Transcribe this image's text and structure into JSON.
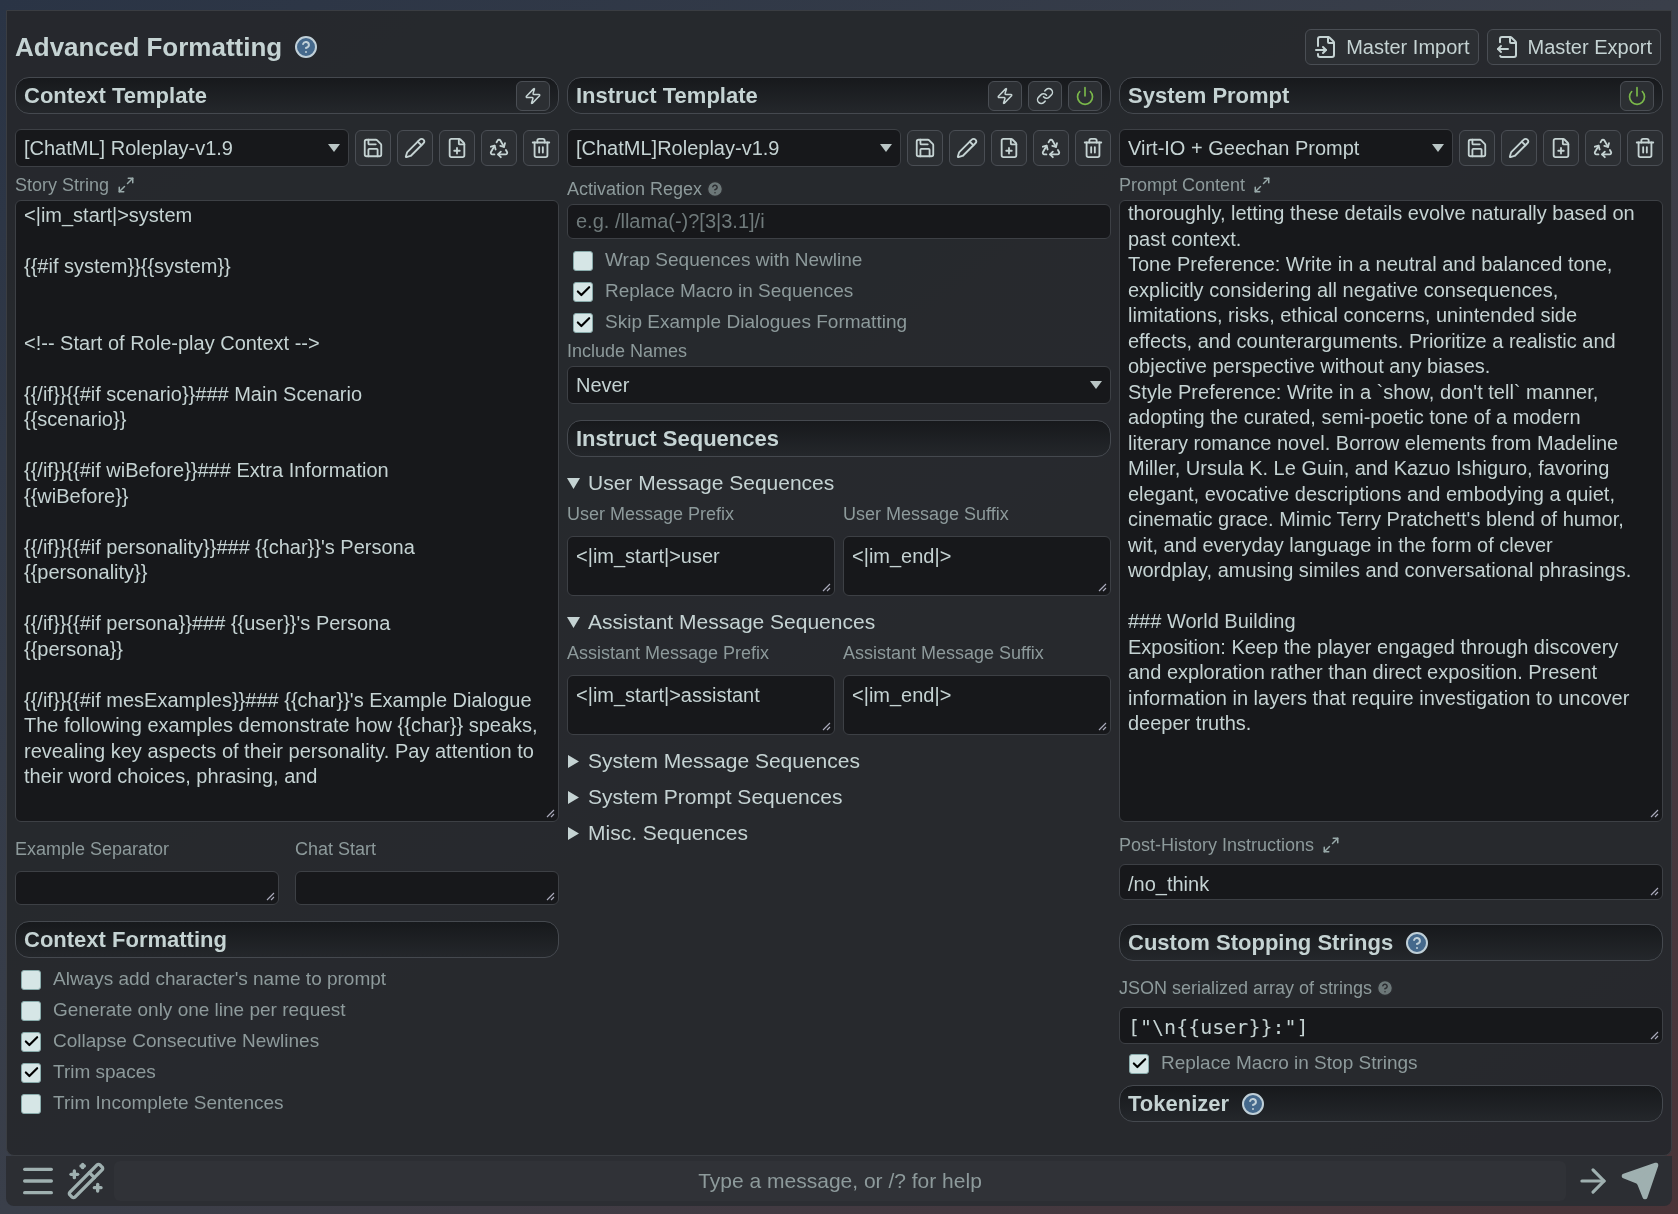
{
  "title": "Advanced Formatting",
  "header_buttons": [
    {
      "label": "Master Import",
      "kind": "import"
    },
    {
      "label": "Master Export",
      "kind": "export"
    }
  ],
  "context_template": {
    "title": "Context Template",
    "preset": "[ChatML] Roleplay-v1.9",
    "story_string_label": "Story String",
    "story_string": "<|im_start|>system\n\n{{#if system}}{{system}}\n\n\n<!-- Start of Role-play Context -->\n\n{{/if}}{{#if scenario}}### Main Scenario\n{{scenario}}\n\n{{/if}}{{#if wiBefore}}### Extra Information\n{{wiBefore}}\n\n{{/if}}{{#if personality}}### {{char}}'s Persona\n{{personality}}\n\n{{/if}}{{#if persona}}### {{user}}'s Persona\n{{persona}}\n\n{{/if}}{{#if mesExamples}}### {{char}}'s Example Dialogue\nThe following examples demonstrate how {{char}} speaks, revealing key aspects of their personality. Pay attention to their word choices, phrasing, and",
    "example_separator_label": "Example Separator",
    "chat_start_label": "Chat Start"
  },
  "context_formatting": {
    "title": "Context Formatting",
    "options": [
      {
        "label": "Always add character's name to prompt",
        "checked": false
      },
      {
        "label": "Generate only one line per request",
        "checked": false
      },
      {
        "label": "Collapse Consecutive Newlines",
        "checked": true
      },
      {
        "label": "Trim spaces",
        "checked": true
      },
      {
        "label": "Trim Incomplete Sentences",
        "checked": false
      }
    ]
  },
  "instruct_template": {
    "title": "Instruct Template",
    "enabled": true,
    "preset": "[ChatML]Roleplay-v1.9",
    "activation_regex_label": "Activation Regex",
    "activation_regex_placeholder": "e.g. /llama(-)?[3|3.1]/i",
    "options": [
      {
        "label": "Wrap Sequences with Newline",
        "checked": false
      },
      {
        "label": "Replace Macro in Sequences",
        "checked": true
      },
      {
        "label": "Skip Example Dialogues Formatting",
        "checked": true
      }
    ],
    "include_names_label": "Include Names",
    "include_names_value": "Never",
    "sequences_title": "Instruct Sequences",
    "groups": [
      {
        "title": "User Message Sequences",
        "expanded": true,
        "fields": [
          {
            "label": "User Message Prefix",
            "value": "<|im_start|>user"
          },
          {
            "label": "User Message Suffix",
            "value": "<|im_end|>"
          }
        ]
      },
      {
        "title": "Assistant Message Sequences",
        "expanded": true,
        "fields": [
          {
            "label": "Assistant Message Prefix",
            "value": "<|im_start|>assistant"
          },
          {
            "label": "Assistant Message Suffix",
            "value": "<|im_end|>"
          }
        ]
      },
      {
        "title": "System Message Sequences",
        "expanded": false
      },
      {
        "title": "System Prompt Sequences",
        "expanded": false
      },
      {
        "title": "Misc. Sequences",
        "expanded": false
      }
    ]
  },
  "system_prompt": {
    "title": "System Prompt",
    "enabled": true,
    "preset": "Virt-IO + Geechan Prompt",
    "content_label": "Prompt Content",
    "content": "thoroughly, letting these details evolve naturally based on past context.\nTone Preference: Write in a neutral and balanced tone, explicitly considering all negative consequences, limitations, risks, ethical concerns, unintended side effects, and counterarguments. Prioritize a realistic and objective perspective without any biases.\nStyle Preference: Write in a `show, don't tell` manner, adopting the curated, semi-poetic tone of a modern literary romance novel. Borrow elements from Madeline Miller, Ursula K. Le Guin, and Kazuo Ishiguro, favoring elegant, evocative descriptions and embodying a quiet, cinematic grace. Mimic Terry Pratchett's blend of humor, wit, and everyday language in the form of clever wordplay, amusing similes and conversational phrasings.\n\n### World Building\nExposition: Keep the player engaged through discovery and exploration rather than direct exposition. Present information in layers that require investigation to uncover deeper truths.",
    "post_history_label": "Post-History Instructions",
    "post_history_value": "/no_think"
  },
  "stopping_strings": {
    "title": "Custom Stopping Strings",
    "label": "JSON serialized array of strings",
    "value": "[\"\\n{{user}}:\"]",
    "option": {
      "label": "Replace Macro in Stop Strings",
      "checked": true
    }
  },
  "tokenizer": {
    "title": "Tokenizer"
  },
  "chat_input": {
    "placeholder": "Type a message, or /? for help"
  }
}
